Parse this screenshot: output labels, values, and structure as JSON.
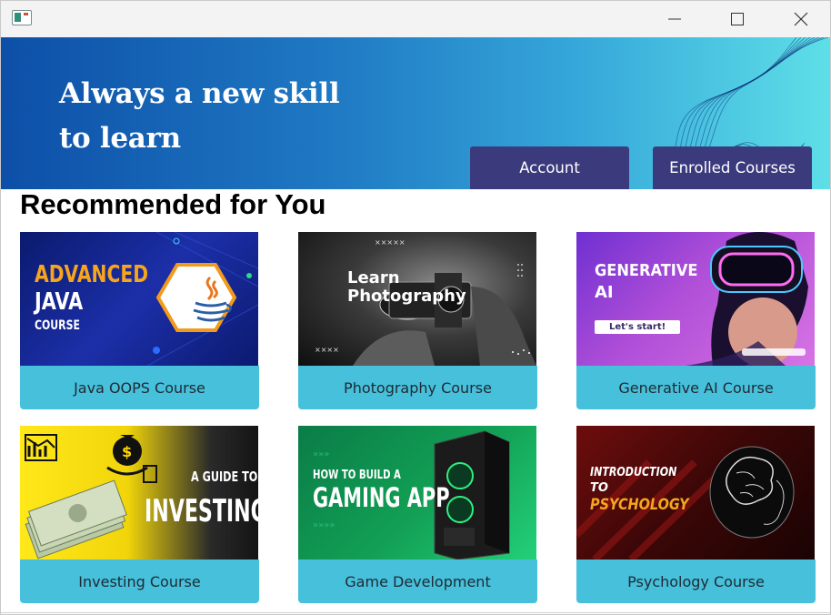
{
  "titlebar": {
    "app_icon": "window-app-icon",
    "minimize_icon": "minimize-icon",
    "maximize_icon": "maximize-icon",
    "close_icon": "close-icon"
  },
  "banner": {
    "headline_line1": "Always a new skill",
    "headline_line2": "to learn",
    "account_label": "Account",
    "enrolled_label": "Enrolled Courses",
    "colors": {
      "gradient_start": "#0d4fa8",
      "gradient_end": "#5edfe7",
      "button_bg": "#3b3a7d"
    }
  },
  "section_title": "Recommended for You",
  "courses": [
    {
      "label": "Java OOPS Course",
      "thumb": {
        "line1": "ADVANCED",
        "line2": "JAVA",
        "line3": "COURSE",
        "icon": "java-coffee-icon"
      }
    },
    {
      "label": "Photography Course",
      "thumb": {
        "line1": "Learn",
        "line2": "Photography",
        "icon": "camera-icon"
      }
    },
    {
      "label": "Generative AI Course",
      "thumb": {
        "line1": "GENERATIVE",
        "line2": "AI",
        "cta": "Let's start!",
        "icon": "vr-headset-icon"
      }
    },
    {
      "label": "Investing Course",
      "thumb": {
        "line1": "A GUIDE TO",
        "line2": "INVESTING",
        "icon": "money-bag-icon"
      }
    },
    {
      "label": "Game Development",
      "thumb": {
        "line1": "HOW TO BUILD A",
        "line2": "GAMING APP",
        "icon": "pc-tower-icon"
      }
    },
    {
      "label": "Psychology Course",
      "thumb": {
        "line1": "INTRODUCTION",
        "line2": "TO",
        "line3": "PSYCHOLOGY",
        "icon": "brain-head-icon"
      }
    }
  ],
  "colors": {
    "card_button_bg": "#47c0db"
  }
}
